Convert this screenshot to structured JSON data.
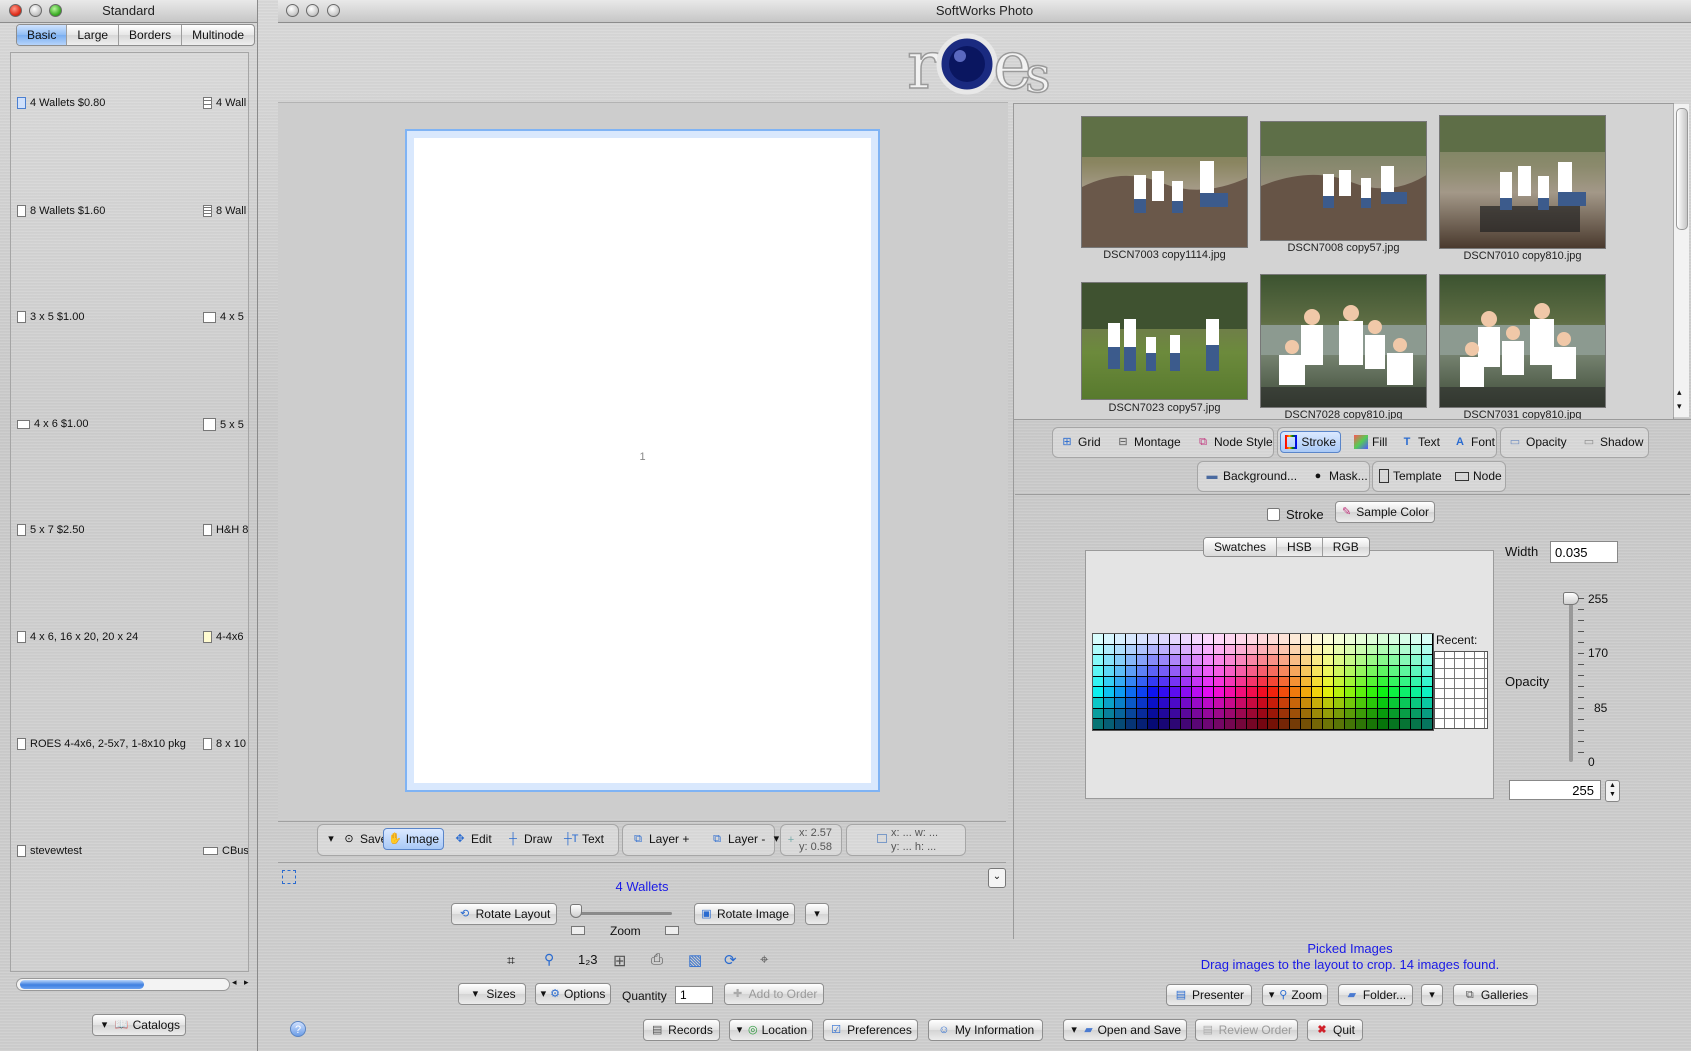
{
  "left_panel": {
    "title": "Standard",
    "tabs": [
      "Basic",
      "Large",
      "Borders",
      "Multinode"
    ],
    "active_tab": "Basic",
    "col1": [
      "4 Wallets $0.80",
      "8 Wallets $1.60",
      "3 x 5 $1.00",
      "4 x 6 $1.00",
      "5 x 7 $2.50",
      "4 x 6, 16 x 20, 20 x 24",
      "ROES 4-4x6, 2-5x7, 1-8x10 pkg",
      "stevewtest"
    ],
    "col2": [
      "4 Wall",
      "8 Wall",
      "4 x 5",
      "5 x 5",
      "H&H 8",
      "4-4x6",
      "8 x 10",
      "CBus"
    ],
    "catalogs_label": "Catalogs"
  },
  "main": {
    "title": "SoftWorks Photo",
    "logo_text": "roes",
    "canvas_number": "1",
    "edit_toolbar": {
      "save": "Save",
      "image": "Image",
      "edit": "Edit",
      "draw": "Draw",
      "text": "Text",
      "layer_plus": "Layer +",
      "layer_minus": "Layer -",
      "coord_x": "x: 2.57",
      "coord_y": "y: 0.58",
      "box_xw": "x: ... w: ...",
      "box_yh": "y: ... h: ..."
    },
    "layout_name": "4 Wallets",
    "rotate_layout": "Rotate Layout",
    "zoom_label": "Zoom",
    "rotate_image": "Rotate Image",
    "sizes": "Sizes",
    "options": "Options",
    "quantity_label": "Quantity",
    "quantity_value": "1",
    "add_to_order": "Add to Order",
    "help": "?"
  },
  "gallery": {
    "images": [
      {
        "name": "DSCN7003 copy1114.jpg"
      },
      {
        "name": "DSCN7008 copy57.jpg"
      },
      {
        "name": "DSCN7010 copy810.jpg"
      },
      {
        "name": "DSCN7023 copy57.jpg"
      },
      {
        "name": "DSCN7028 copy810.jpg"
      },
      {
        "name": "DSCN7031 copy810.jpg"
      }
    ]
  },
  "style_toolbar": {
    "row1": [
      "Grid",
      "Montage",
      "Node Style",
      "Stroke",
      "Fill",
      "Text",
      "Font",
      "Opacity",
      "Shadow"
    ],
    "row2": [
      "Background...",
      "Mask...",
      "Template",
      "Node"
    ],
    "active": "Stroke"
  },
  "stroke_panel": {
    "stroke_label": "Stroke",
    "sample_color": "Sample Color",
    "color_tabs": [
      "Swatches",
      "HSB",
      "RGB"
    ],
    "recent_label": "Recent:",
    "width_label": "Width",
    "width_value": "0.035",
    "opacity_label": "Opacity",
    "opacity_ticks": [
      "255",
      "170",
      "85",
      "0"
    ],
    "opacity_value": "255"
  },
  "picked": {
    "title": "Picked Images",
    "subtitle": "Drag images to the layout to crop. 14 images found."
  },
  "bottom_buttons": {
    "presenter": "Presenter",
    "zoom": "Zoom",
    "folder": "Folder...",
    "galleries": "Galleries",
    "records": "Records",
    "location": "Location",
    "preferences": "Preferences",
    "my_information": "My Information",
    "open_and_save": "Open and Save",
    "review_order": "Review Order",
    "quit": "Quit"
  },
  "colors": {
    "accent": "#3a7bd5",
    "link_blue": "#1a1ae6",
    "selection": "#8fbcf4"
  }
}
